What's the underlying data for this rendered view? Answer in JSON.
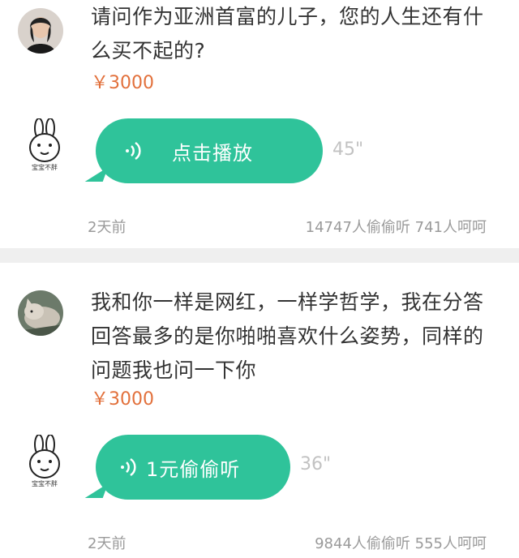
{
  "posts": [
    {
      "question": "请问作为亚洲首富的儿子，您的人生还有什么买不起的?",
      "price": "￥3000",
      "answerer_label": "宝宝不胖",
      "bubble_label": "点击播放",
      "duration": "45\"",
      "time": "2天前",
      "stats": "14747人偷偷听  741人呵呵"
    },
    {
      "question": "我和你一样是网红，一样学哲学，我在分答回答最多的是你啪啪喜欢什么姿势，同样的问题我也问一下你",
      "price": "￥3000",
      "answerer_label": "宝宝不胖",
      "bubble_label": "1元偷偷听",
      "duration": "36\"",
      "time": "2天前",
      "stats": "9844人偷偷听  555人呵呵"
    }
  ],
  "colors": {
    "bubble": "#2fc39a",
    "price": "#e2703b",
    "meta": "#9a9a9a",
    "duration": "#c2c2c2",
    "separator": "#efefef"
  }
}
